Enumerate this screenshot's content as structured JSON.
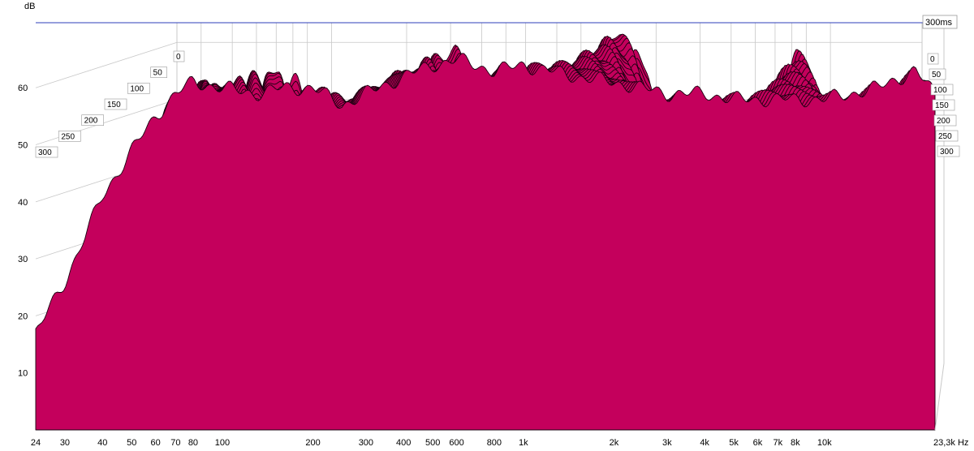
{
  "chart_data": {
    "type": "area",
    "subtype": "waterfall (cumulative spectral decay)",
    "ylabel": "dB",
    "x_unit": "Hz",
    "x_scale": "log",
    "xlim": [
      24,
      23300
    ],
    "ylim": [
      0,
      68
    ],
    "time_range_ms": [
      0,
      300
    ],
    "grid": true,
    "colors": {
      "fill": "#c4005c",
      "stroke": "#1a0010",
      "grid": "#c8c8c8",
      "axis": "#2d3fb8"
    },
    "x_ticks": [
      {
        "value": 24,
        "label": "24"
      },
      {
        "value": 30,
        "label": "30"
      },
      {
        "value": 40,
        "label": "40"
      },
      {
        "value": 50,
        "label": "50"
      },
      {
        "value": 60,
        "label": "60"
      },
      {
        "value": 70,
        "label": "70"
      },
      {
        "value": 80,
        "label": "80"
      },
      {
        "value": 100,
        "label": "100"
      },
      {
        "value": 200,
        "label": "200"
      },
      {
        "value": 300,
        "label": "300"
      },
      {
        "value": 400,
        "label": "400"
      },
      {
        "value": 500,
        "label": "500"
      },
      {
        "value": 600,
        "label": "600"
      },
      {
        "value": 800,
        "label": "800"
      },
      {
        "value": 1000,
        "label": "1k"
      },
      {
        "value": 2000,
        "label": "2k"
      },
      {
        "value": 3000,
        "label": "3k"
      },
      {
        "value": 4000,
        "label": "4k"
      },
      {
        "value": 5000,
        "label": "5k"
      },
      {
        "value": 6000,
        "label": "6k"
      },
      {
        "value": 7000,
        "label": "7k"
      },
      {
        "value": 8000,
        "label": "8k"
      },
      {
        "value": 10000,
        "label": "10k"
      },
      {
        "value": 23300,
        "label": "23,3k Hz"
      }
    ],
    "y_ticks": [
      {
        "value": 10,
        "label": "10"
      },
      {
        "value": 20,
        "label": "20"
      },
      {
        "value": 30,
        "label": "30"
      },
      {
        "value": 40,
        "label": "40"
      },
      {
        "value": 50,
        "label": "50"
      },
      {
        "value": 60,
        "label": "60"
      }
    ],
    "time_ticks_left": [
      "0",
      "50",
      "100",
      "150",
      "200",
      "250",
      "300"
    ],
    "time_ticks_right": [
      "0",
      "50",
      "100",
      "150",
      "200",
      "250",
      "300"
    ],
    "back_label": "300ms",
    "slice_count": 55,
    "front_slice": [
      {
        "x": 24,
        "y": 17
      },
      {
        "x": 30,
        "y": 26
      },
      {
        "x": 35,
        "y": 34
      },
      {
        "x": 40,
        "y": 41
      },
      {
        "x": 50,
        "y": 49
      },
      {
        "x": 60,
        "y": 55
      },
      {
        "x": 70,
        "y": 59
      },
      {
        "x": 80,
        "y": 61
      },
      {
        "x": 100,
        "y": 60
      },
      {
        "x": 130,
        "y": 59
      },
      {
        "x": 160,
        "y": 60
      },
      {
        "x": 200,
        "y": 60
      },
      {
        "x": 250,
        "y": 57
      },
      {
        "x": 300,
        "y": 59
      },
      {
        "x": 400,
        "y": 62
      },
      {
        "x": 500,
        "y": 64
      },
      {
        "x": 600,
        "y": 65
      },
      {
        "x": 800,
        "y": 63
      },
      {
        "x": 1000,
        "y": 64
      },
      {
        "x": 1500,
        "y": 62
      },
      {
        "x": 2000,
        "y": 61
      },
      {
        "x": 3000,
        "y": 59
      },
      {
        "x": 4000,
        "y": 59
      },
      {
        "x": 5000,
        "y": 58
      },
      {
        "x": 6000,
        "y": 58
      },
      {
        "x": 7000,
        "y": 58
      },
      {
        "x": 8000,
        "y": 58
      },
      {
        "x": 10000,
        "y": 58
      },
      {
        "x": 15000,
        "y": 60
      },
      {
        "x": 20000,
        "y": 63
      },
      {
        "x": 23300,
        "y": 59
      }
    ]
  }
}
